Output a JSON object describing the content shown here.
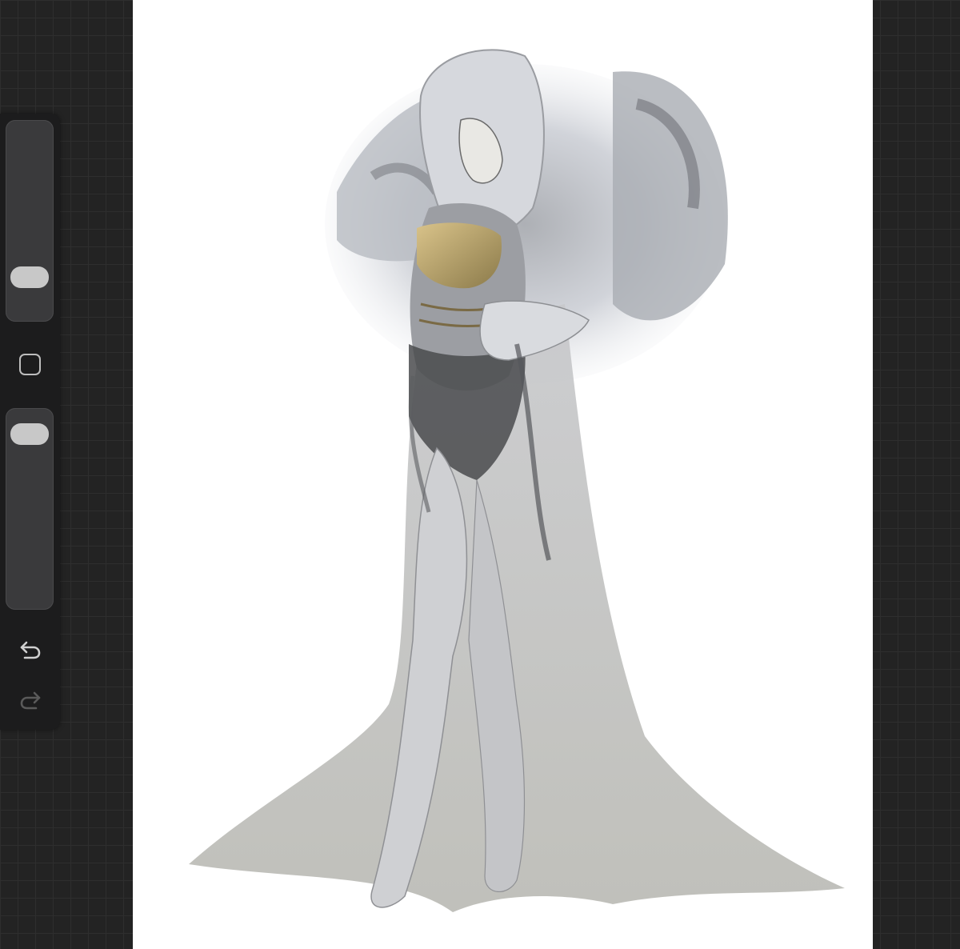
{
  "app": {
    "canvas_background": "#ffffff",
    "workspace_background": "#232323"
  },
  "sidebar": {
    "brush_size": 0.25,
    "brush_opacity": 0.92,
    "modifier_icon": "square-icon",
    "undo_icon": "undo-arrow-icon",
    "redo_icon": "redo-arrow-icon",
    "redo_enabled": false
  },
  "artwork": {
    "description_icon": "painting-canvas"
  }
}
